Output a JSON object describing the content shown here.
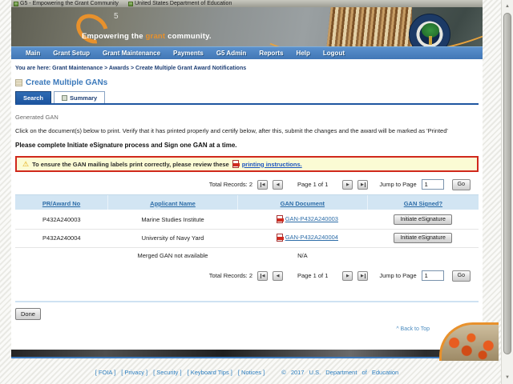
{
  "window": {
    "titles": [
      "G5 - Empowering the Grant Community",
      "United States Department of Education"
    ]
  },
  "banner": {
    "logo_number": "5",
    "tagline_prefix": "Empowering the ",
    "tagline_highlight": "grant",
    "tagline_suffix": " community."
  },
  "nav": {
    "items": [
      "Main",
      "Grant Setup",
      "Grant Maintenance",
      "Payments",
      "G5 Admin",
      "Reports",
      "Help",
      "Logout"
    ]
  },
  "breadcrumb": {
    "label": "You are here:",
    "trail": "Grant Maintenance > Awards > Create Multiple Grant Award Notifications"
  },
  "page": {
    "title": "Create Multiple GANs",
    "tabs": {
      "search": "Search",
      "summary": "Summary"
    },
    "section_label": "Generated GAN",
    "instructions": "Click on the document(s) below to print. Verify that it has printed properly and certify below, after this, submit the changes and the award will be marked as 'Printed'",
    "esign_note": "Please complete Initiate eSignature process and Sign one GAN at a time.",
    "warning_text": "To ensure the GAN mailing labels print correctly, please review these",
    "warning_link": "printing instructions."
  },
  "pagination": {
    "total": "Total Records: 2",
    "page": "Page 1 of 1",
    "jump_label": "Jump to Page",
    "jump_value": "1",
    "go": "Go"
  },
  "table": {
    "headers": [
      "PR/Award No",
      "Applicant Name",
      "GAN Document",
      "GAN Signed?"
    ],
    "rows": [
      {
        "award": "P432A240003",
        "applicant": "Marine Studies Institute",
        "doc": "GAN-P432A240003",
        "action": "Initiate eSignature"
      },
      {
        "award": "P432A240004",
        "applicant": "University of Navy Yard",
        "doc": "GAN-P432A240004",
        "action": "Initiate eSignature"
      }
    ],
    "merged_label": "Merged GAN not available",
    "merged_value": "N/A"
  },
  "done_label": "Done",
  "footer": {
    "back_to_top": "^ Back to Top",
    "links": [
      "[ FOIA ]",
      "[ Privacy ]",
      "[ Security ]",
      "[ Keyboard Tips ]",
      "[ Notices ]"
    ],
    "copyright": "© 2017 U.S. Department of Education"
  },
  "icons": {
    "warning": "⚠",
    "first_page": "◀",
    "prev_page": "◀",
    "next_page": "▶",
    "last_page": "▶",
    "scroll_up": "▲",
    "scroll_down": "▼"
  },
  "colors": {
    "nav_blue": "#4d86c5",
    "accent_orange": "#e8912c",
    "link_blue": "#2d6da8",
    "tab_blue": "#1d55a0",
    "warning_border": "#d0281c",
    "warning_bg": "#fbfbd4",
    "table_header_bg": "#d2e5f3"
  }
}
